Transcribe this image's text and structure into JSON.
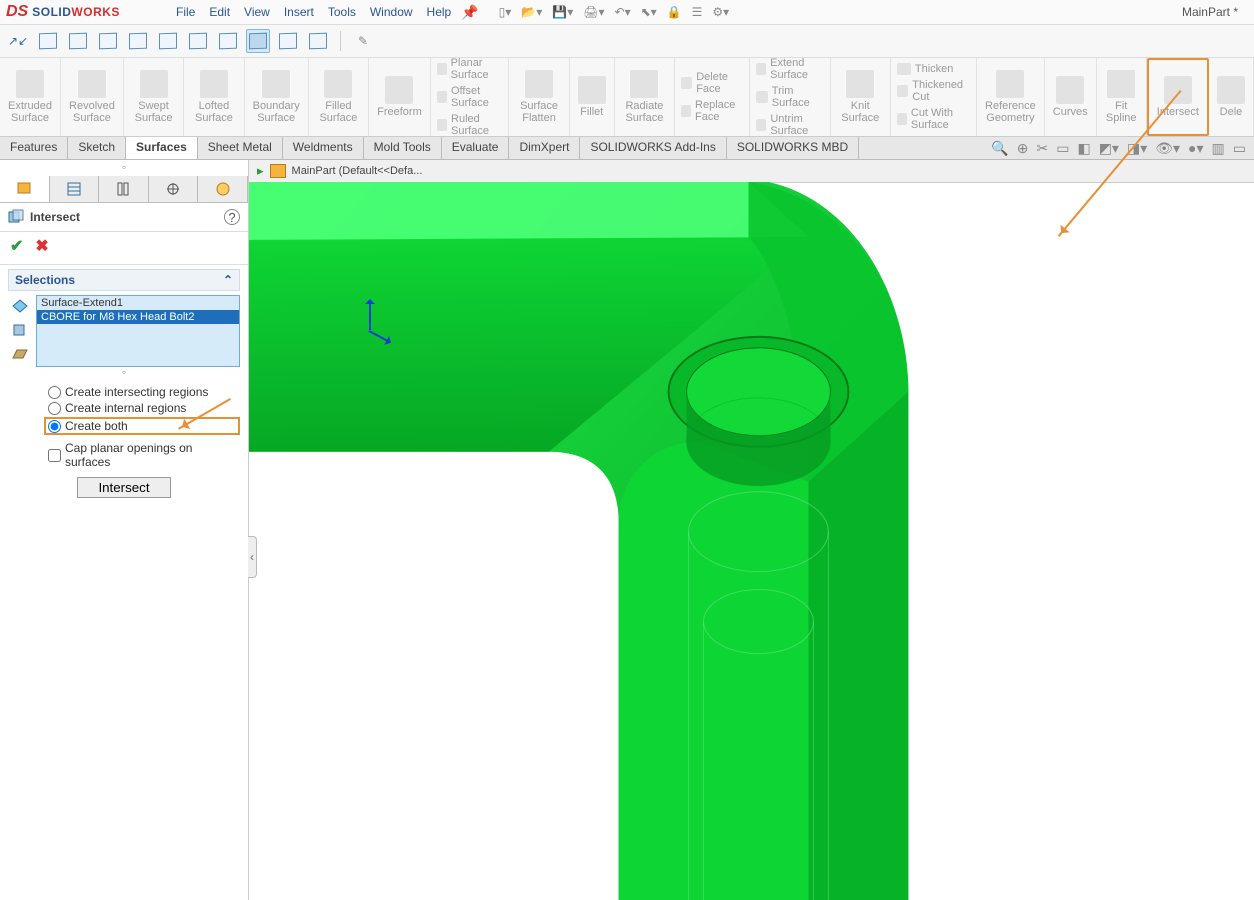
{
  "app": {
    "title": "MainPart *"
  },
  "logo": {
    "mark": "DS",
    "text_a": "SOLID",
    "text_b": "WORKS"
  },
  "menubar": [
    "File",
    "Edit",
    "View",
    "Insert",
    "Tools",
    "Window",
    "Help"
  ],
  "ribbon_big": [
    {
      "label": "Extruded Surface"
    },
    {
      "label": "Revolved Surface"
    },
    {
      "label": "Swept Surface"
    },
    {
      "label": "Lofted Surface"
    },
    {
      "label": "Boundary Surface"
    },
    {
      "label": "Filled Surface"
    },
    {
      "label": "Freeform"
    }
  ],
  "ribbon_surface_cmds": [
    "Planar Surface",
    "Offset Surface",
    "Ruled Surface"
  ],
  "ribbon_mid": [
    {
      "label": "Surface Flatten"
    },
    {
      "label": "Fillet"
    },
    {
      "label": "Radiate Surface"
    }
  ],
  "ribbon_face_cmds": [
    "Delete Face",
    "Replace Face"
  ],
  "ribbon_trim_cmds": [
    "Extend Surface",
    "Trim Surface",
    "Untrim Surface"
  ],
  "ribbon_knit": "Knit Surface",
  "ribbon_thick_cmds": [
    "Thicken",
    "Thickened Cut",
    "Cut With Surface"
  ],
  "ribbon_right": [
    {
      "label": "Reference Geometry"
    },
    {
      "label": "Curves"
    },
    {
      "label": "Fit Spline"
    },
    {
      "label": "Intersect",
      "highlight": true
    },
    {
      "label": "Dele"
    }
  ],
  "feature_tabs": [
    "Features",
    "Sketch",
    "Surfaces",
    "Sheet Metal",
    "Weldments",
    "Mold Tools",
    "Evaluate",
    "DimXpert",
    "SOLIDWORKS Add-Ins",
    "SOLIDWORKS MBD"
  ],
  "active_feature_tab": "Surfaces",
  "vp_tab": "MainPart  (Default<<Defa...",
  "pm": {
    "title": "Intersect",
    "section": "Selections",
    "list": [
      "Surface-Extend1",
      "CBORE for M8 Hex Head Bolt2"
    ],
    "selected_index": 1,
    "radios": {
      "r1": "Create intersecting regions",
      "r2": "Create internal regions",
      "r3": "Create both"
    },
    "checkbox": "Cap planar openings on surfaces",
    "button": "Intersect",
    "collapse": "⌃"
  }
}
